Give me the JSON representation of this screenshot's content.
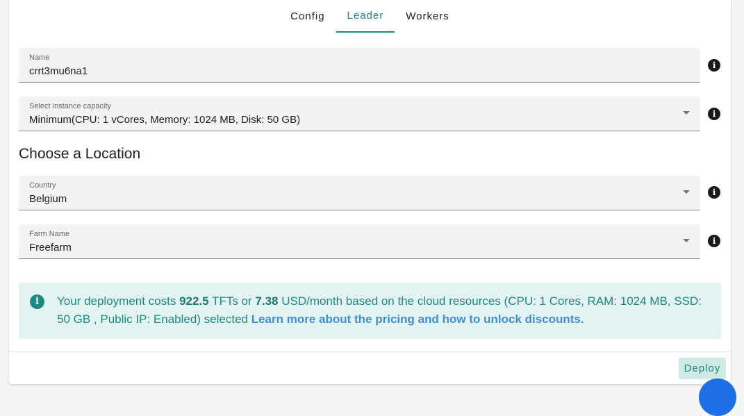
{
  "tabs": [
    {
      "label": "Config",
      "active": false
    },
    {
      "label": "Leader",
      "active": true
    },
    {
      "label": "Workers",
      "active": false
    }
  ],
  "fields": {
    "name": {
      "label": "Name",
      "value": "crrt3mu6na1"
    },
    "capacity": {
      "label": "Select instance capacity",
      "value": "Minimum(CPU: 1 vCores, Memory: 1024 MB, Disk: 50 GB)"
    },
    "country": {
      "label": "Country",
      "value": "Belgium"
    },
    "farm": {
      "label": "Farm Name",
      "value": "Freefarm"
    }
  },
  "location_title": "Choose a Location",
  "alert": {
    "prefix": "Your deployment costs ",
    "tft_value": "922.5",
    "middle": " TFTs or ",
    "usd_value": "7.38",
    "suffix": " USD/month based on the cloud resources (CPU: 1 Cores, RAM: 1024 MB, SSD: 50 GB , Public IP: Enabled) selected ",
    "link": "Learn more about the pricing and how to unlock discounts."
  },
  "deploy_label": "Deploy",
  "icons": {
    "info": "info-icon",
    "dropdown": "caret-down-icon"
  },
  "colors": {
    "accent": "#1c8a80",
    "link": "#3f8fd8",
    "alert_bg": "#e3f3f1",
    "fab": "#1e6fe6"
  }
}
